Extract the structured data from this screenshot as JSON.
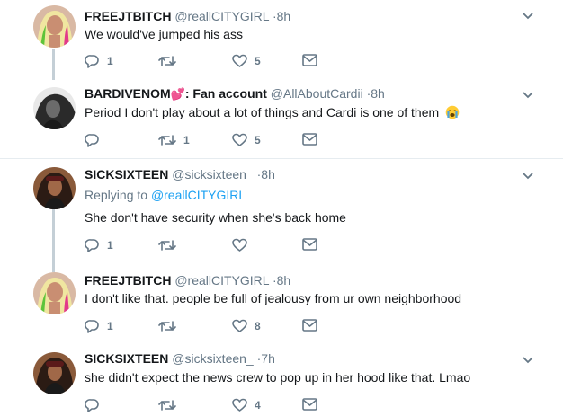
{
  "tweets": [
    {
      "name": "FREEJTBITCH",
      "handle": "@reallCITYGIRL",
      "time": "8h",
      "text": "We would've jumped his ass",
      "replies": "1",
      "retweets": "",
      "likes": "5",
      "avatar": "avatar-blonde"
    },
    {
      "name": "BARDIVENOM",
      "label": ": Fan account",
      "handle": "@AllAboutCardii",
      "time": "8h",
      "text": "Period I don't play about a lot of things and Cardi is one of them",
      "replies": "",
      "retweets": "1",
      "likes": "5",
      "avatar": "avatar-bw"
    },
    {
      "name": "SICKSIXTEEN",
      "handle": "@sicksixteen_",
      "time": "8h",
      "replying_prefix": "Replying to ",
      "replying_to": "@reallCITYGIRL",
      "text": "She don't have security when she's back home",
      "replies": "1",
      "retweets": "",
      "likes": "",
      "avatar": "avatar-dark"
    },
    {
      "name": "FREEJTBITCH",
      "handle": "@reallCITYGIRL",
      "time": "8h",
      "text": "I don't like that. people be full of jealousy from ur own neighborhood",
      "replies": "1",
      "retweets": "",
      "likes": "8",
      "avatar": "avatar-blonde"
    },
    {
      "name": "SICKSIXTEEN",
      "handle": "@sicksixteen_",
      "time": "7h",
      "text": "she didn't expect the news crew to pop up in her hood like that. Lmao",
      "replies": "",
      "retweets": "",
      "likes": "4",
      "avatar": "avatar-dark"
    }
  ],
  "separator": "·",
  "colors": {
    "accent": "#1da1f2",
    "muted": "#657786",
    "thread": "#c4cfd6",
    "heart": "#e0245e"
  }
}
